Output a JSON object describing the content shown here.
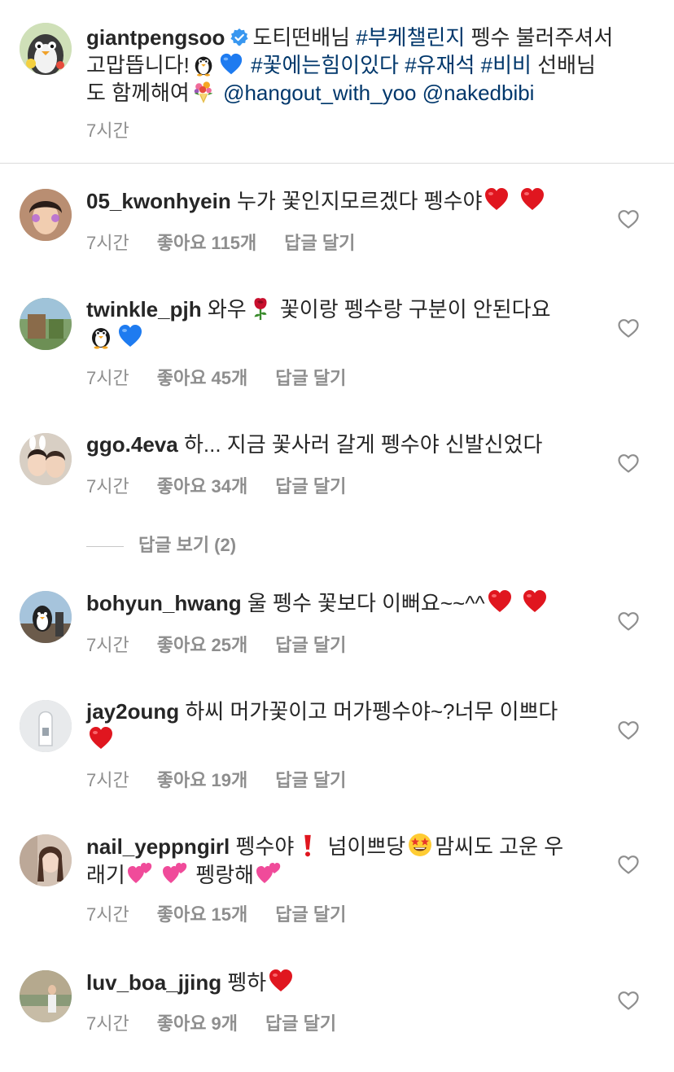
{
  "caption": {
    "username": "giantpengsoo",
    "verified": true,
    "line1_text": "도티떤배님",
    "hashtag_1": "#부케챌린지",
    "line1_text2": "펭수 불러주셔서",
    "line2_text": "고맙뜹니다!",
    "hashtag_2": "#꽃에는힘이있다",
    "hashtag_3": "#유재석",
    "hashtag_4": "#비비",
    "line2_text2": "선배님",
    "line3_text": "도 함께해여",
    "mention_1": "@hangout_with_yoo",
    "mention_2": "@nakedbibi",
    "time": "7시간"
  },
  "view_replies_label": "답글 보기 (2)",
  "reply_label": "답글 달기",
  "comments": [
    {
      "username": "05_kwonhyein",
      "text": "누가 꽃인지모르겠다 펭수야",
      "time": "7시간",
      "likes": "좋아요 115개"
    },
    {
      "username": "twinkle_pjh",
      "text": "와우",
      "text2": "꽃이랑 펭수랑 구분이 안된다요",
      "time": "7시간",
      "likes": "좋아요 45개"
    },
    {
      "username": "ggo.4eva",
      "text": "하... 지금 꽃사러 갈게 펭수야 신발신었다",
      "time": "7시간",
      "likes": "좋아요 34개"
    },
    {
      "username": "bohyun_hwang",
      "text": "울 펭수 꽃보다 이뻐요~~^^",
      "time": "7시간",
      "likes": "좋아요 25개"
    },
    {
      "username": "jay2oung",
      "text": "하씨 머가꽃이고 머가펭수야~?너무 이쁘다",
      "time": "7시간",
      "likes": "좋아요 19개"
    },
    {
      "username": "nail_yeppngirl",
      "text": "펭수야",
      "text2": "넘이쁘당",
      "text3": "맘씨도 고운 우",
      "text4": "래기",
      "text5": "펭랑해",
      "time": "7시간",
      "likes": "좋아요 15개"
    },
    {
      "username": "luv_boa_jjing",
      "text": "펭하",
      "time": "7시간",
      "likes": "좋아요 9개"
    }
  ],
  "icons": {
    "verified": "verified-badge-icon",
    "like": "heart-outline-icon",
    "emoji_heart_red": "red-heart-emoji",
    "emoji_heart_blue": "blue-heart-emoji",
    "emoji_penguin": "penguin-emoji",
    "emoji_rose": "rose-emoji",
    "emoji_bouquet": "bouquet-emoji",
    "emoji_exclamation": "red-exclamation-emoji",
    "emoji_starstruck": "star-struck-emoji",
    "emoji_two_hearts": "two-hearts-emoji"
  },
  "colors": {
    "link": "#00376b",
    "meta": "#8e8e8e",
    "verified": "#3897f0",
    "heart_red": "#e0161f"
  }
}
